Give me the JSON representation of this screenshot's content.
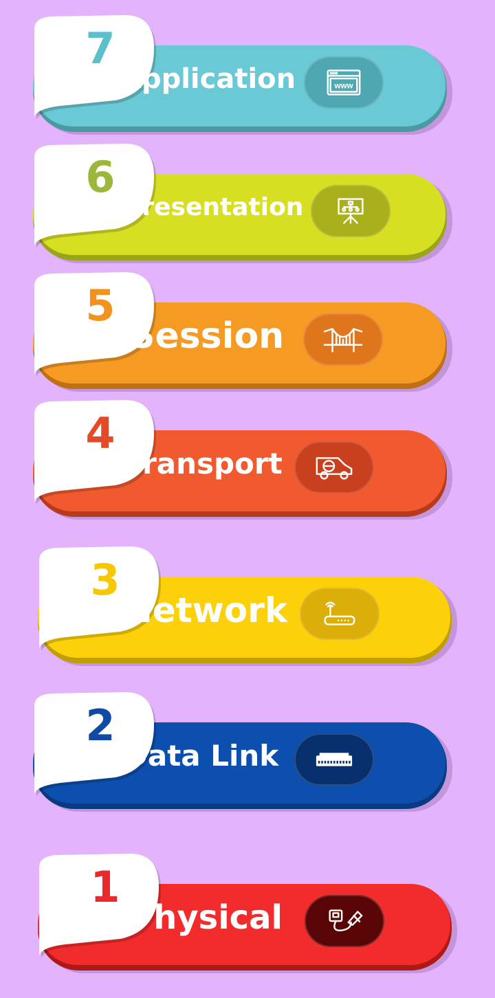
{
  "layers": [
    {
      "number": "7",
      "name": "Application",
      "icon": "browser-www-icon",
      "icon_text": "www",
      "color": "#69c9d4",
      "dark": "#4a9aa3",
      "icon_bg": "#4fa7b2",
      "num_color": "#5bbfcc"
    },
    {
      "number": "6",
      "name": "Presentation",
      "icon": "presentation-board-icon",
      "color": "#d7df23",
      "dark": "#9aa51a",
      "icon_bg": "#a9b01c",
      "num_color": "#9bb83a"
    },
    {
      "number": "5",
      "name": "Session",
      "icon": "bridge-icon",
      "color": "#f59a23",
      "dark": "#c06f12",
      "icon_bg": "#e0761c",
      "num_color": "#f1931d"
    },
    {
      "number": "4",
      "name": "Transport",
      "icon": "delivery-van-icon",
      "color": "#f15a2e",
      "dark": "#b8391b",
      "icon_bg": "#c9401e",
      "num_color": "#e34a27"
    },
    {
      "number": "3",
      "name": "Network",
      "icon": "wifi-router-icon",
      "color": "#fdd10a",
      "dark": "#c09e00",
      "icon_bg": "#dcae0a",
      "num_color": "#f7c700"
    },
    {
      "number": "2",
      "name": "Data Link",
      "icon": "network-switch-icon",
      "color": "#0d4fae",
      "dark": "#093a82",
      "icon_bg": "#07306c",
      "num_color": "#0f4aa3"
    },
    {
      "number": "1",
      "name": "Physical",
      "icon": "ethernet-cable-icon",
      "color": "#f22c2c",
      "dark": "#b01818",
      "icon_bg": "#5a0505",
      "num_color": "#ea2a2a"
    }
  ]
}
